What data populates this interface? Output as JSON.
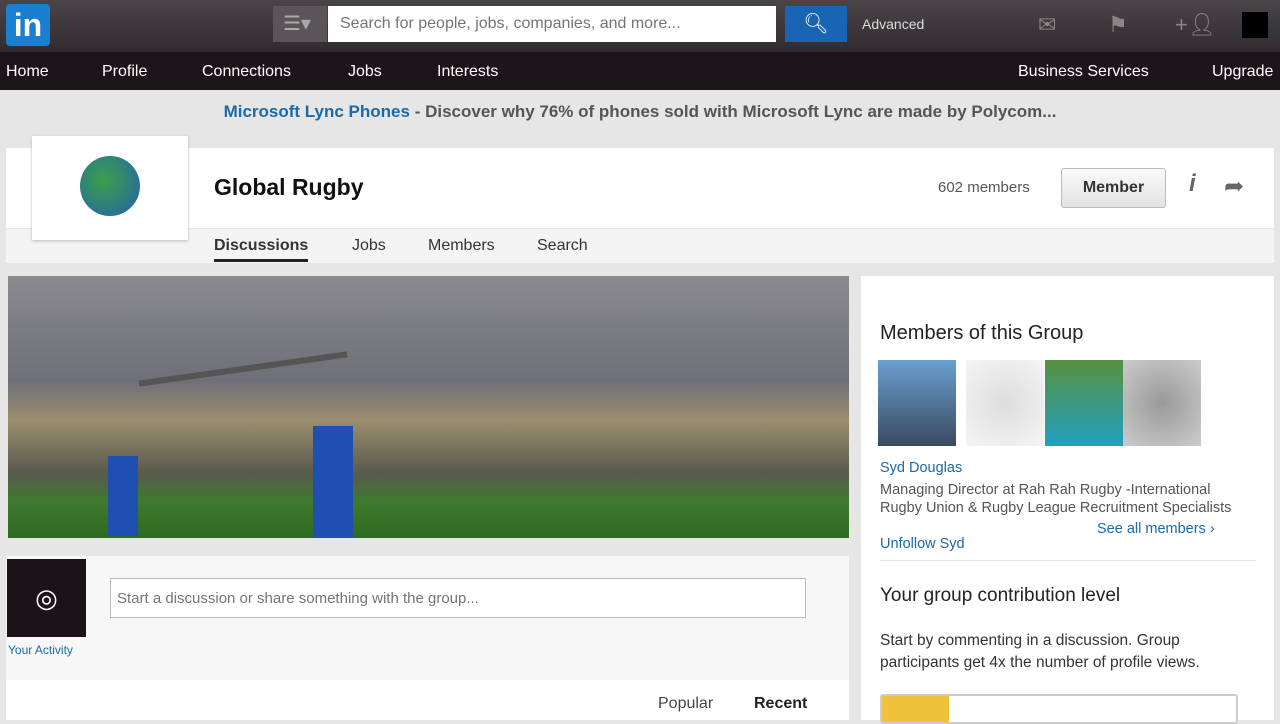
{
  "topbar": {
    "logo": "in",
    "search_placeholder": "Search for people, jobs, companies, and more...",
    "advanced": "Advanced"
  },
  "nav": {
    "items": [
      "Home",
      "Profile",
      "Connections",
      "Jobs",
      "Interests"
    ],
    "right": [
      "Business Services",
      "Upgrade"
    ]
  },
  "ad": {
    "link": "Microsoft Lync Phones",
    "text": " - Discover why 76% of phones sold with Microsoft Lync are made by Polycom..."
  },
  "group": {
    "title": "Global Rugby",
    "members": "602 members",
    "member_button": "Member",
    "tabs": [
      "Discussions",
      "Jobs",
      "Members",
      "Search"
    ]
  },
  "post": {
    "placeholder": "Start a discussion or share something with the group...",
    "your_activity": "Your Activity",
    "sort": [
      "Popular",
      "Recent"
    ]
  },
  "sidebar": {
    "members_title": "Members of this Group",
    "member_name": "Syd Douglas",
    "member_headline": "Managing Director at Rah Rah Rugby -International Rugby Union & Rugby League Recruitment Specialists",
    "unfollow": "Unfollow Syd",
    "see_all": "See all members ›",
    "contribution_title": "Your group contribution level",
    "contribution_text": "Start by commenting in a discussion. Group participants get 4x the number of profile views.",
    "contribution_level_percent": 19
  },
  "colors": {
    "accent": "#1a6aa8",
    "bar": "#f0c23a"
  }
}
